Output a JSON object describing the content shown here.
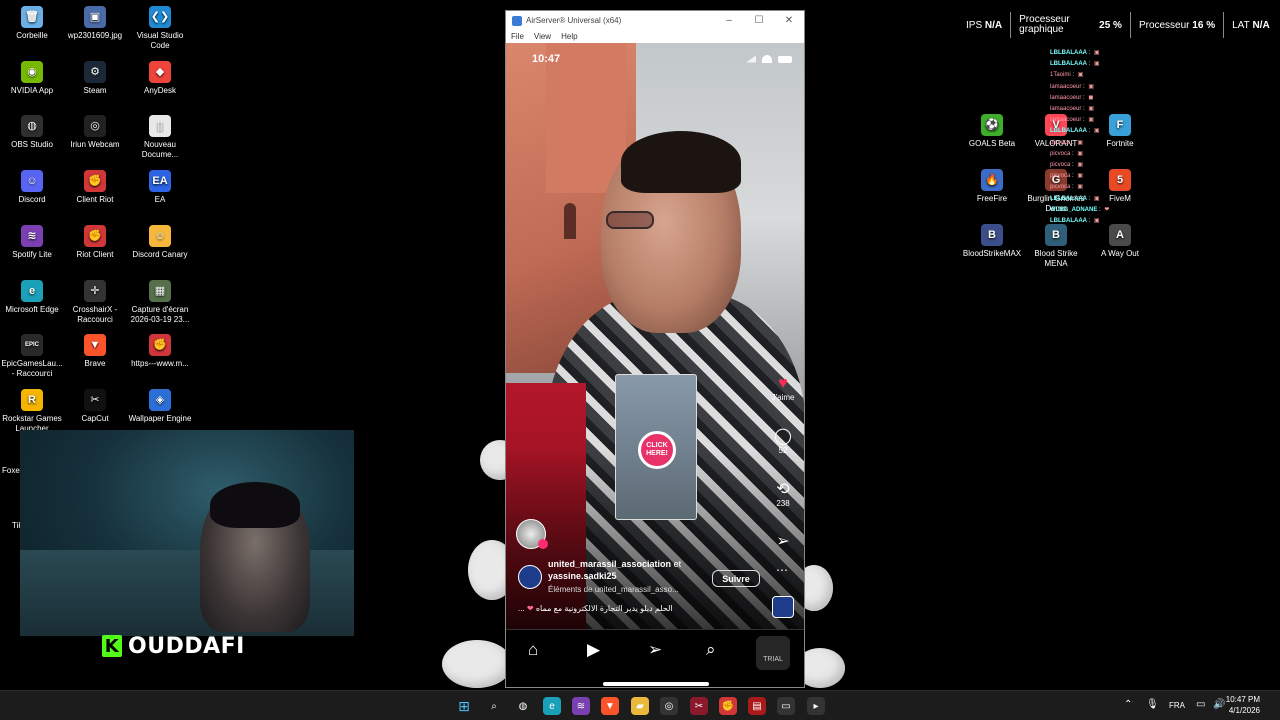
{
  "desktop_icons": [
    {
      "label": "Corbeille",
      "icon": "recycle-bin-icon",
      "color": "#6ab0e6",
      "glyph": "🗑"
    },
    {
      "label": "wp2301609.jpg",
      "icon": "image-file-icon",
      "color": "#4a6aa8",
      "glyph": "▣"
    },
    {
      "label": "Visual Studio Code",
      "icon": "vscode-icon",
      "color": "#1f8ad2",
      "glyph": "❮❯"
    },
    {
      "label": "NVIDIA App",
      "icon": "nvidia-icon",
      "color": "#76b900",
      "glyph": "◉"
    },
    {
      "label": "Steam",
      "icon": "steam-icon",
      "color": "#1b2838",
      "glyph": "⚙"
    },
    {
      "label": "AnyDesk",
      "icon": "anydesk-icon",
      "color": "#ef443b",
      "glyph": "◆"
    },
    {
      "label": "OBS Studio",
      "icon": "obs-icon",
      "color": "#302e31",
      "glyph": "◍"
    },
    {
      "label": "Iriun Webcam",
      "icon": "webcam-icon",
      "color": "#222",
      "glyph": "◎"
    },
    {
      "label": "Nouveau Docume...",
      "icon": "document-icon",
      "color": "#e8e8e8",
      "glyph": "▯"
    },
    {
      "label": "Discord",
      "icon": "discord-icon",
      "color": "#5865f2",
      "glyph": "☺"
    },
    {
      "label": "Client Riot",
      "icon": "riot-icon",
      "color": "#d13639",
      "glyph": "✊"
    },
    {
      "label": "EA",
      "icon": "ea-icon",
      "color": "#2c64e3",
      "glyph": "EA"
    },
    {
      "label": "Spotify Lite",
      "icon": "spotify-icon",
      "color": "#7a3fb1",
      "glyph": "≋"
    },
    {
      "label": "Riot Client",
      "icon": "riot-icon",
      "color": "#d13639",
      "glyph": "✊"
    },
    {
      "label": "Discord Canary",
      "icon": "discord-canary-icon",
      "color": "#f6b73c",
      "glyph": "☺"
    },
    {
      "label": "Microsoft Edge",
      "icon": "edge-icon",
      "color": "#1aa0b8",
      "glyph": "e"
    },
    {
      "label": "CrosshairX - Raccourci",
      "icon": "crosshair-icon",
      "color": "#333",
      "glyph": "✛"
    },
    {
      "label": "Capture d'écran 2026-03-19 23...",
      "icon": "screenshot-file-icon",
      "color": "#55704a",
      "glyph": "▦"
    },
    {
      "label": "EpicGamesLau... - Raccourci",
      "icon": "epic-games-icon",
      "color": "#2a2a2a",
      "glyph": "EPIC"
    },
    {
      "label": "Brave",
      "icon": "brave-icon",
      "color": "#fb542b",
      "glyph": "▼"
    },
    {
      "label": "https---www.m...",
      "icon": "shortcut-icon",
      "color": "#d13639",
      "glyph": "✊"
    },
    {
      "label": "Rockstar Games Launcher",
      "icon": "rockstar-icon",
      "color": "#f4b400",
      "glyph": "R"
    },
    {
      "label": "CapCut",
      "icon": "capcut-icon",
      "color": "#111",
      "glyph": "✂"
    },
    {
      "label": "Wallpaper Engine",
      "icon": "wallpaper-engine-icon",
      "color": "#2b6fd6",
      "glyph": "◈"
    }
  ],
  "right_icons": [
    {
      "label": "GOALS Beta",
      "icon": "goals-icon",
      "color": "#3fae2a",
      "glyph": "⚽"
    },
    {
      "label": "VALORANT",
      "icon": "valorant-icon",
      "color": "#ff4655",
      "glyph": "V"
    },
    {
      "label": "Fortnite",
      "icon": "fortnite-icon",
      "color": "#3aa0d8",
      "glyph": "F"
    },
    {
      "label": "FreeFire",
      "icon": "freefire-icon",
      "color": "#3a6cc8",
      "glyph": "🔥"
    },
    {
      "label": "Burglin Gnomes Demo",
      "icon": "burglin-gnomes-icon",
      "color": "#8a3b2b",
      "glyph": "G"
    },
    {
      "label": "FiveM",
      "icon": "fivem-icon",
      "color": "#e84a24",
      "glyph": "5"
    },
    {
      "label": "BloodStrikeMAX",
      "icon": "bloodstrike-max-icon",
      "color": "#3b4e8a",
      "glyph": "B"
    },
    {
      "label": "Blood Strike MENA",
      "icon": "bloodstrike-mena-icon",
      "color": "#2f5f7a",
      "glyph": "B"
    },
    {
      "label": "A Way Out",
      "icon": "a-way-out-icon",
      "color": "#4a4a4a",
      "glyph": "A"
    }
  ],
  "left_cut": {
    "foxer": "Foxer",
    "tik": "Tik"
  },
  "perf_overlay": {
    "ips_label": "IPS",
    "ips_value": "N/A",
    "gpu_label": "Processeur graphique",
    "gpu_value": "25 %",
    "cpu_label": "Processeur",
    "cpu_value": "16 %",
    "lat_label": "LAT",
    "lat_value": "N/A"
  },
  "chat": [
    {
      "user": "LBLBALAAA",
      "badge": "▣"
    },
    {
      "user": "LBLBALAAA",
      "badge": "▣"
    },
    {
      "user": "1Taoimi",
      "badge": "▣"
    },
    {
      "user": "lamaacoeur",
      "badge": "▣"
    },
    {
      "user": "lamaacoeur",
      "badge": "◼"
    },
    {
      "user": "lamaacoeur",
      "badge": "▣"
    },
    {
      "user": "lamaacoeur",
      "badge": "▣"
    },
    {
      "user": "LBLBALAAA",
      "badge": "▣"
    },
    {
      "user": "picvoca",
      "badge": "▣"
    },
    {
      "user": "picvoca",
      "badge": "▣"
    },
    {
      "user": "picvoca",
      "badge": "▣"
    },
    {
      "user": "picvoca",
      "badge": "▣"
    },
    {
      "user": "picvoca",
      "badge": "▣"
    },
    {
      "user": "LBLBALAAA",
      "badge": "▣"
    },
    {
      "user": "WLBG_ADNANE",
      "badge": "❤"
    },
    {
      "user": "LBLBALAAA",
      "badge": "▣"
    }
  ],
  "webcam": {
    "brand": "OUDDAFI",
    "brand_logo": "K",
    "accent": "#53fc18"
  },
  "window": {
    "title": "AirServer® Universal (x64)",
    "menu": [
      "File",
      "View",
      "Help"
    ],
    "min": "–",
    "max": "☐",
    "close": "✕"
  },
  "phone": {
    "time": "10:47",
    "likes_label": "J'aime",
    "comments": "52",
    "reposts": "238",
    "username": "united_marassil_association",
    "and": "et",
    "collab": "yassine.sadki25",
    "follow": "Suivre",
    "elements_prefix": "Éléments de",
    "elements_user": "united_marassil_asso...",
    "caption_text": "الحلم ديلو يدير التجارة الالكترونية مع مماه",
    "caption_prefix": "...",
    "ad_text": "CLICK HERE!",
    "trial": "TRIAL"
  },
  "taskbar": {
    "lang": "FRA",
    "time": "10:47 PM",
    "date": "4/1/2026",
    "apps": [
      {
        "icon": "windows-start-icon",
        "glyph": "⊞",
        "color": "#1c1c1c"
      },
      {
        "icon": "search-icon",
        "glyph": "⌕",
        "color": "#1c1c1c"
      },
      {
        "icon": "obs-icon",
        "glyph": "◍",
        "color": "#1c1c1c"
      },
      {
        "icon": "edge-icon",
        "glyph": "e",
        "color": "#1aa0b8"
      },
      {
        "icon": "spotify-icon",
        "glyph": "≋",
        "color": "#7a3fb1"
      },
      {
        "icon": "brave-icon",
        "glyph": "▼",
        "color": "#fb542b"
      },
      {
        "icon": "file-explorer-icon",
        "glyph": "▰",
        "color": "#e8b93a"
      },
      {
        "icon": "chrome-icon",
        "glyph": "◎",
        "color": "#333"
      },
      {
        "icon": "capcut-icon",
        "glyph": "✂",
        "color": "#8a1a2b"
      },
      {
        "icon": "riot-icon",
        "glyph": "✊",
        "color": "#d13639"
      },
      {
        "icon": "stream-app-icon",
        "glyph": "▤",
        "color": "#aa1a1a"
      },
      {
        "icon": "airserver-icon",
        "glyph": "▭",
        "color": "#333"
      },
      {
        "icon": "terminal-icon",
        "glyph": "▸",
        "color": "#333"
      }
    ]
  }
}
